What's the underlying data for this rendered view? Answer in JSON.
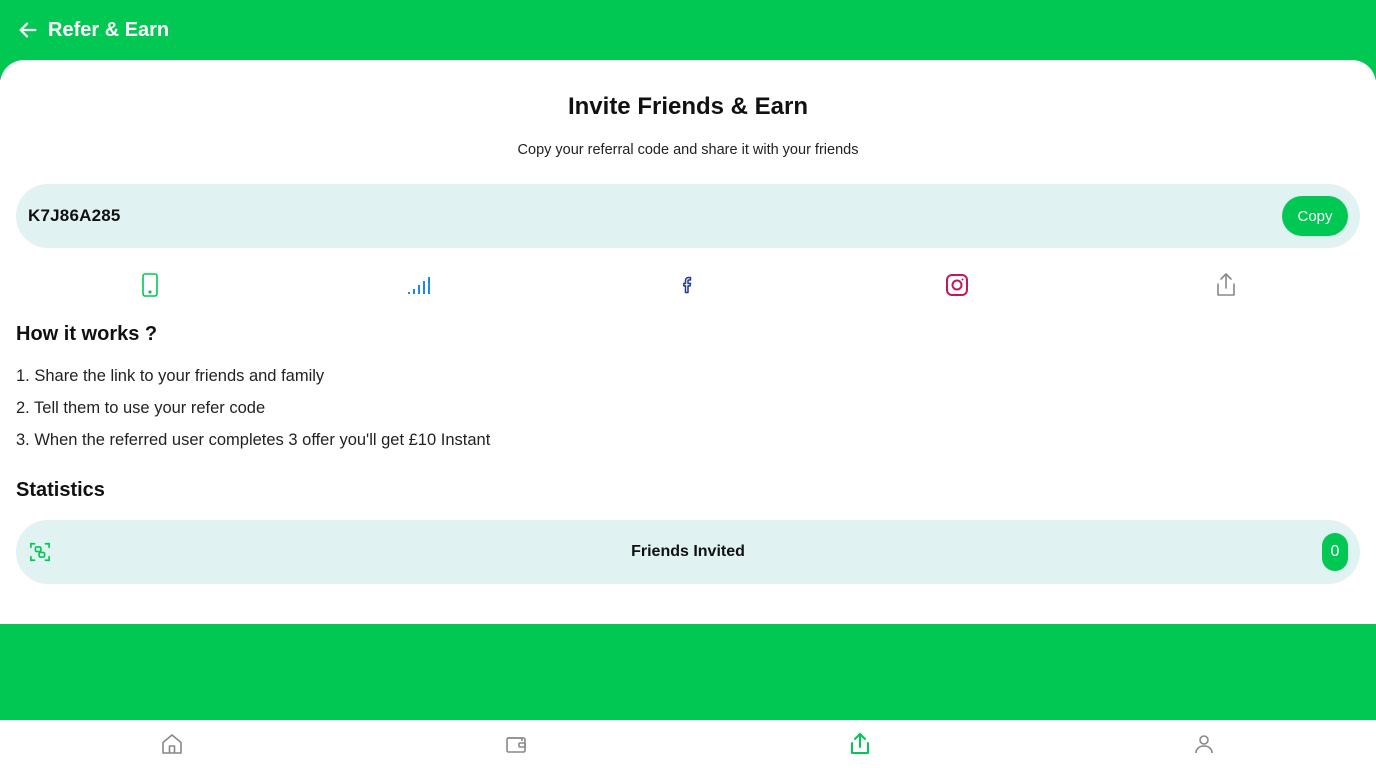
{
  "header": {
    "title": "Refer & Earn",
    "back_icon": "arrow-left-icon"
  },
  "invite": {
    "title": "Invite Friends & Earn",
    "subtitle": "Copy your referral code and share it with your friends",
    "code": "K7J86A285",
    "copy_label": "Copy"
  },
  "share": {
    "icons": [
      "phone-icon",
      "signal-icon",
      "facebook-icon",
      "instagram-icon",
      "share-icon"
    ]
  },
  "how_it_works": {
    "title": "How it works ?",
    "steps": [
      "1. Share the link to your friends and family",
      "2. Tell them to use your refer code",
      "3. When the referred user completes 3 offer you'll get £10 Instant"
    ]
  },
  "statistics": {
    "title": "Statistics",
    "friends_invited_label": "Friends Invited",
    "friends_invited_count": "0"
  },
  "bottom_nav": {
    "items": [
      "home-icon",
      "wallet-icon",
      "share-icon",
      "profile-icon"
    ],
    "active": "share-icon"
  },
  "colors": {
    "brand": "#00c853",
    "pill_bg": "#e0f2f1",
    "facebook": "#1f3a8a",
    "instagram": "#c2185b",
    "signal": "#1e88e5"
  }
}
